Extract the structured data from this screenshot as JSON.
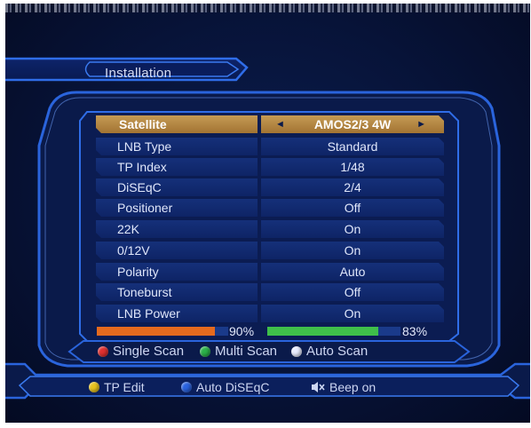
{
  "window": {
    "title": "Installation"
  },
  "settings": {
    "rows": [
      {
        "label": "Satellite",
        "value": "AMOS2/3 4W",
        "selected": true
      },
      {
        "label": "LNB Type",
        "value": "Standard"
      },
      {
        "label": "TP Index",
        "value": "1/48"
      },
      {
        "label": "DiSEqC",
        "value": "2/4"
      },
      {
        "label": "Positioner",
        "value": "Off"
      },
      {
        "label": "22K",
        "value": "On"
      },
      {
        "label": "0/12V",
        "value": "On"
      },
      {
        "label": "Polarity",
        "value": "Auto"
      },
      {
        "label": "Toneburst",
        "value": "Off"
      },
      {
        "label": "LNB Power",
        "value": "On"
      }
    ],
    "selector_arrows": {
      "left": "◄",
      "right": "►"
    }
  },
  "signal": {
    "strength": {
      "percent": 90,
      "label": "90%",
      "color": "#e66a1e"
    },
    "quality": {
      "percent": 83,
      "label": "83%",
      "color": "#3fbf4a"
    }
  },
  "scan_actions": [
    {
      "label": "Single Scan",
      "key": "red",
      "color": "#e03030"
    },
    {
      "label": "Multi Scan",
      "key": "green",
      "color": "#2bb24a"
    },
    {
      "label": "Auto Scan",
      "key": "white",
      "color": "#e8ecff"
    }
  ],
  "footer_actions": {
    "tp_edit": {
      "label": "TP Edit",
      "key": "yellow",
      "color": "#e8c31d"
    },
    "auto_diseqc": {
      "label": "Auto DiSEqC",
      "key": "blue",
      "color": "#2a63e0"
    },
    "beep": {
      "label": "Beep on",
      "icon": "speaker-mute-icon"
    }
  },
  "theme": {
    "frame": "#2a64dc",
    "frame_glow": "#6fa1ff",
    "panel": "#0a1a4a"
  }
}
